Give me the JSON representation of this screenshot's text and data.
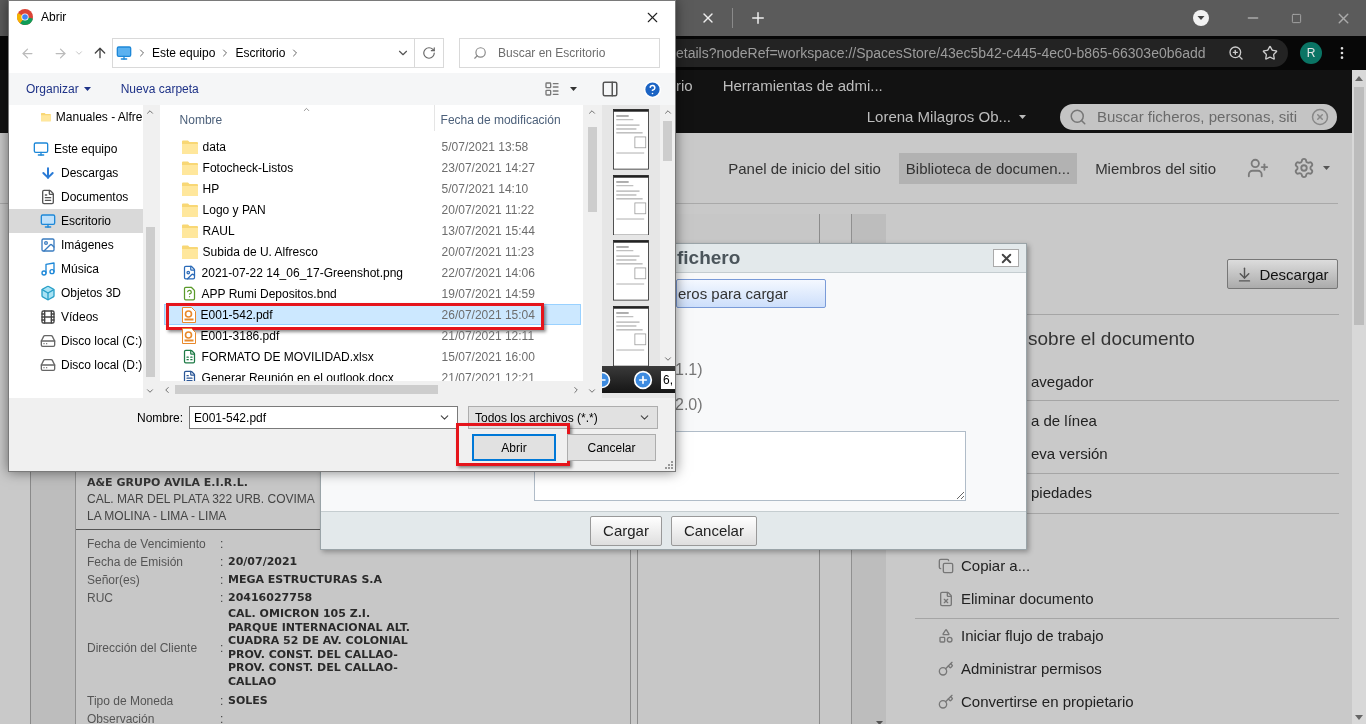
{
  "browser": {
    "url": "etails?nodeRef=workspace://SpacesStore/43ec5b42-c445-4ec0-b865-66303e0b6add",
    "avatar": "R"
  },
  "app_header": {
    "menu": [
      "rio",
      "Herramientas de admi..."
    ],
    "user": "Lorena Milagros Ob...",
    "search": {
      "placeholder": "Buscar ficheros, personas, siti"
    }
  },
  "site_nav": [
    {
      "label": "Panel de inicio del sitio",
      "selected": false
    },
    {
      "label": "Biblioteca de documen...",
      "selected": true
    },
    {
      "label": "Miembros del sitio",
      "selected": false
    }
  ],
  "download_button": "Descargar",
  "document_actions": {
    "heading": "sobre el documento",
    "sections": [
      [
        {
          "kind": "clipped",
          "label": "avegador"
        }
      ],
      [
        {
          "kind": "clipped",
          "label": "a de línea"
        },
        {
          "kind": "clipped",
          "label": "eva versión"
        }
      ],
      [
        {
          "kind": "clipped",
          "label": "piedades"
        }
      ],
      [
        {
          "kind": "action",
          "label": "Copiar a..."
        },
        {
          "kind": "action",
          "label": "Eliminar documento"
        }
      ],
      [
        {
          "kind": "action",
          "label": "Iniciar flujo de trabajo"
        },
        {
          "kind": "action",
          "label": "Administrar permisos"
        },
        {
          "kind": "action",
          "label": "Convertirse en propietario"
        }
      ]
    ]
  },
  "preview_document": {
    "company": "A&E GRUPO AVILA E.I.R.L.",
    "address": [
      "CAL. MAR DEL PLATA 322 URB. COVIMA",
      "LA MOLINA - LIMA - LIMA"
    ],
    "fields": [
      {
        "label": "Fecha de Vencimiento",
        "separator": ":"
      },
      {
        "label": "Fecha de Emisión",
        "separator": ":",
        "value": [
          "20/07/2021"
        ]
      },
      {
        "label": "Señor(es)",
        "separator": ":",
        "value": [
          "MEGA ESTRUCTURAS S.A"
        ]
      },
      {
        "label": "RUC",
        "separator": ":",
        "value": [
          "20416027758"
        ]
      },
      {
        "label": "Dirección del Cliente",
        "separator": ":",
        "value": [
          "CAL. OMICRON 105 Z.I.",
          "PARQUE INTERNACIONAL ALT.",
          "CUADRA 52 DE AV. COLONIAL",
          "PROV. CONST. DEL CALLAO-",
          "PROV. CONST. DEL CALLAO-",
          "CALLAO"
        ]
      },
      {
        "label": "Tipo de Moneda",
        "separator": ":",
        "value": [
          "SOLES"
        ]
      },
      {
        "label": "Observación",
        "separator": ":"
      }
    ]
  },
  "upload_dialog": {
    "title": "fichero",
    "select_button": "eros para cargar",
    "versions": [
      "1.1)",
      "2.0)"
    ],
    "buttons": [
      "Cargar",
      "Cancelar"
    ]
  },
  "file_dialog": {
    "title": "Abrir",
    "breadcrumb": [
      "Este equipo",
      "Escritorio"
    ],
    "search": {
      "placeholder": "Buscar en Escritorio"
    },
    "toolbar": [
      "Organizar",
      "Nueva carpeta"
    ],
    "nav_pane": [
      {
        "label": "Manuales - Alfre",
        "kind": "folder",
        "selected": false
      },
      {
        "label": "Este equipo",
        "kind": "computer",
        "selected": false,
        "children": [
          {
            "label": "Descargas",
            "kind": "downloads",
            "selected": false
          },
          {
            "label": "Documentos",
            "kind": "documents",
            "selected": false
          },
          {
            "label": "Escritorio",
            "kind": "desktop",
            "selected": true
          },
          {
            "label": "Imágenes",
            "kind": "pictures",
            "selected": false
          },
          {
            "label": "Música",
            "kind": "music",
            "selected": false
          },
          {
            "label": "Objetos 3D",
            "kind": "objects3d",
            "selected": false
          },
          {
            "label": "Vídeos",
            "kind": "videos",
            "selected": false
          },
          {
            "label": "Disco local (C:)",
            "kind": "drive",
            "selected": false
          },
          {
            "label": "Disco local (D:)",
            "kind": "drive",
            "selected": false
          }
        ]
      }
    ],
    "columns": [
      "Nombre",
      "Fecha de modificación"
    ],
    "files": [
      {
        "name": "data",
        "date": "5/07/2021 13:58",
        "kind": "folder",
        "selected": false,
        "highlighted": false
      },
      {
        "name": "Fotocheck-Listos",
        "date": "23/07/2021 14:27",
        "kind": "folder",
        "selected": false,
        "highlighted": false
      },
      {
        "name": "HP",
        "date": "5/07/2021 14:10",
        "kind": "folder",
        "selected": false,
        "highlighted": false
      },
      {
        "name": "Logo y PAN",
        "date": "20/07/2021 11:22",
        "kind": "folder",
        "selected": false,
        "highlighted": false
      },
      {
        "name": "RAUL",
        "date": "13/07/2021 15:44",
        "kind": "folder",
        "selected": false,
        "highlighted": false
      },
      {
        "name": "Subida de U. Alfresco",
        "date": "20/07/2021 11:23",
        "kind": "folder",
        "selected": false,
        "highlighted": false
      },
      {
        "name": "2021-07-22 14_06_17-Greenshot.png",
        "date": "22/07/2021 14:06",
        "kind": "image",
        "selected": false,
        "highlighted": false
      },
      {
        "name": "APP Rumi Depositos.bnd",
        "date": "19/07/2021 14:59",
        "kind": "package",
        "selected": false,
        "highlighted": false
      },
      {
        "name": "E001-542.pdf",
        "date": "26/07/2021 15:04",
        "kind": "pdf",
        "selected": true,
        "highlighted": true
      },
      {
        "name": "E001-3186.pdf",
        "date": "21/07/2021 12:11",
        "kind": "pdf",
        "selected": false,
        "highlighted": false
      },
      {
        "name": "FORMATO DE MOVILIDAD.xlsx",
        "date": "15/07/2021 16:00",
        "kind": "spreadsheet",
        "selected": false,
        "highlighted": false
      },
      {
        "name": "Generar Reunión en el outlook.docx",
        "date": "21/07/2021 12:21",
        "kind": "document",
        "selected": false,
        "highlighted": false
      }
    ],
    "filename_label": "Nombre:",
    "filename": "E001-542.pdf",
    "filter": "Todos los archivos (*.*)",
    "preview": {
      "zoom": "6,"
    },
    "buttons": [
      {
        "label": "Abrir",
        "focused": true,
        "highlighted": true
      },
      {
        "label": "Cancelar",
        "focused": false,
        "highlighted": false
      }
    ]
  }
}
